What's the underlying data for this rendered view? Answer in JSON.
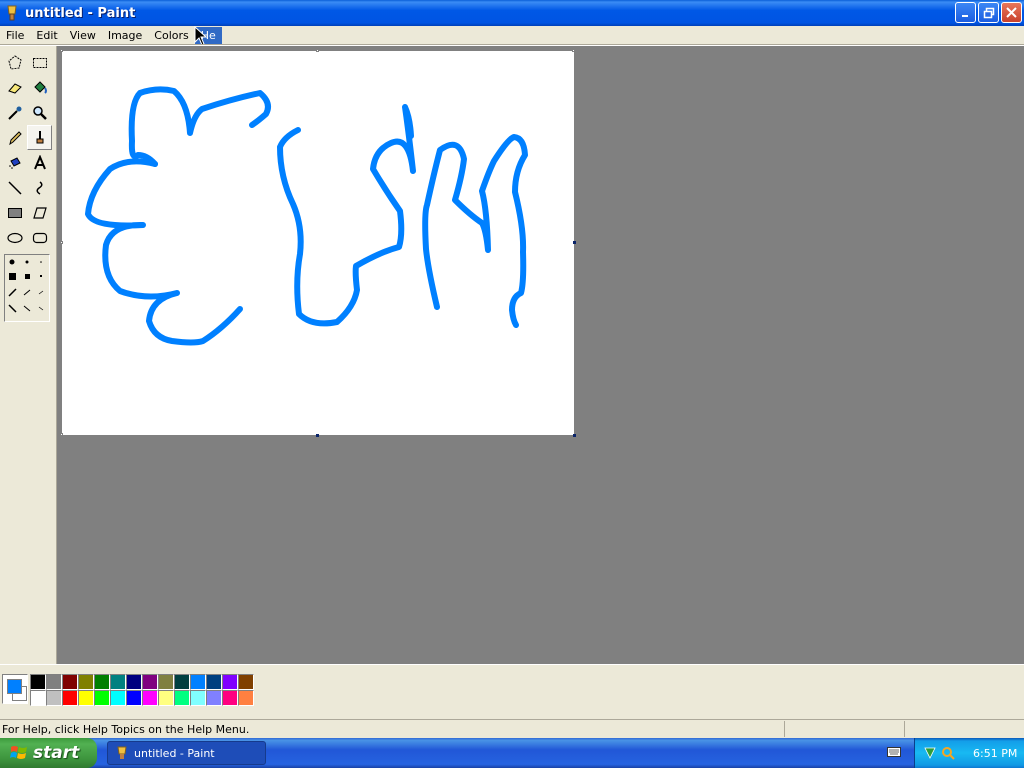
{
  "window": {
    "title": "untitled - Paint",
    "buttons": [
      "minimize",
      "maximize",
      "close"
    ]
  },
  "menu": {
    "items": [
      "File",
      "Edit",
      "View",
      "Image",
      "Colors",
      "He"
    ],
    "active_index": 5
  },
  "toolbox": {
    "tools": [
      "free-form-select-icon",
      "select-icon",
      "eraser-icon",
      "fill-icon",
      "pick-color-icon",
      "magnifier-icon",
      "pencil-icon",
      "brush-icon",
      "airbrush-icon",
      "text-icon",
      "line-icon",
      "curve-icon",
      "rectangle-icon",
      "polygon-icon",
      "ellipse-icon",
      "rounded-rectangle-icon"
    ],
    "selected_tool": "brush-icon"
  },
  "palette": {
    "foreground": "#0080FF",
    "background": "#FFFFFF",
    "top_row": [
      "#000000",
      "#808080",
      "#800000",
      "#808000",
      "#008000",
      "#008080",
      "#000080",
      "#800080",
      "#808040",
      "#004040",
      "#0080FF",
      "#004080",
      "#8000FF",
      "#804000"
    ],
    "bottom_row": [
      "#FFFFFF",
      "#C0C0C0",
      "#FF0000",
      "#FFFF00",
      "#00FF00",
      "#00FFFF",
      "#0000FF",
      "#FF00FF",
      "#FFFF80",
      "#00FF80",
      "#80FFFF",
      "#8080FF",
      "#FF0080",
      "#FF8040"
    ]
  },
  "statusbar": {
    "text": "For Help, click Help Topics on the Help Menu."
  },
  "taskbar": {
    "start_label": "start",
    "task_label": "untitled - Paint",
    "time": "6:51 PM"
  }
}
